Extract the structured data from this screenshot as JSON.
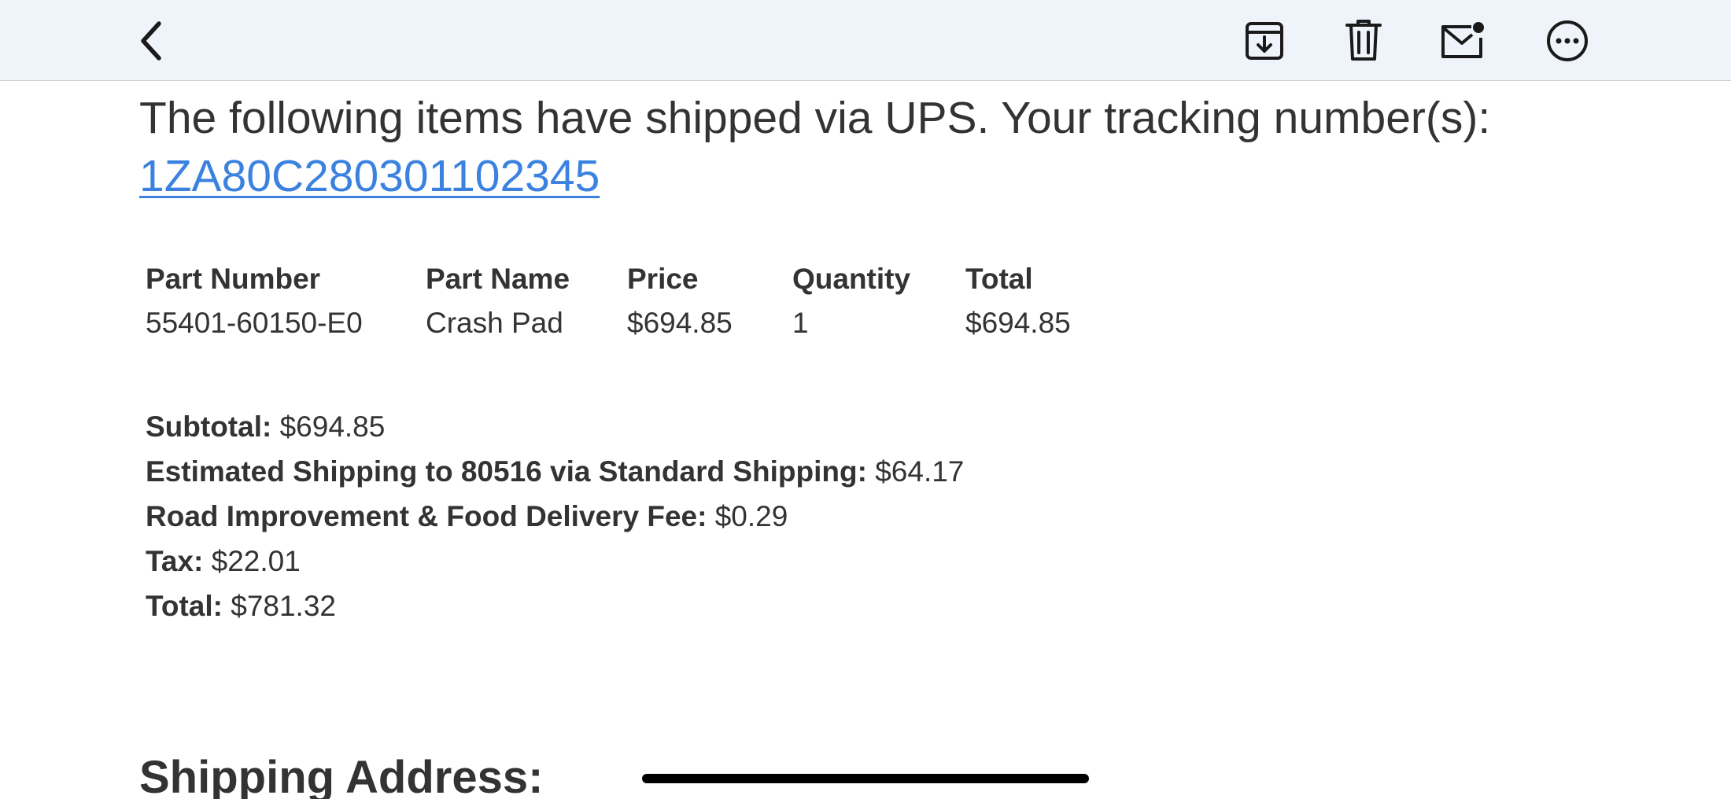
{
  "toolbar": {
    "back_icon": "chevron-left-icon",
    "archive_icon": "archive-tray-icon",
    "trash_icon": "trash-icon",
    "mail_icon": "envelope-unread-icon",
    "more_icon": "ellipsis-circle-icon"
  },
  "email": {
    "intro_text": "The following items have shipped via UPS. Your tracking number(s):",
    "tracking_number": "1ZA80C280301102345",
    "table": {
      "headers": {
        "part_number": "Part Number",
        "part_name": "Part Name",
        "price": "Price",
        "quantity": "Quantity",
        "total": "Total"
      },
      "rows": [
        {
          "part_number": "55401-60150-E0",
          "part_name": "Crash Pad",
          "price": "$694.85",
          "quantity": "1",
          "total": "$694.85"
        }
      ]
    },
    "summary": {
      "subtotal_label": "Subtotal:",
      "subtotal_value": "$694.85",
      "shipping_label": "Estimated Shipping to 80516 via Standard Shipping:",
      "shipping_value": "$64.17",
      "fee_label": "Road Improvement & Food Delivery Fee:",
      "fee_value": "$0.29",
      "tax_label": "Tax:",
      "tax_value": "$22.01",
      "total_label": "Total:",
      "total_value": "$781.32"
    },
    "shipping_address_heading": "Shipping Address:"
  },
  "colors": {
    "toolbar_bg": "#eff4fb",
    "link": "#3b82e0",
    "text": "#333333"
  }
}
